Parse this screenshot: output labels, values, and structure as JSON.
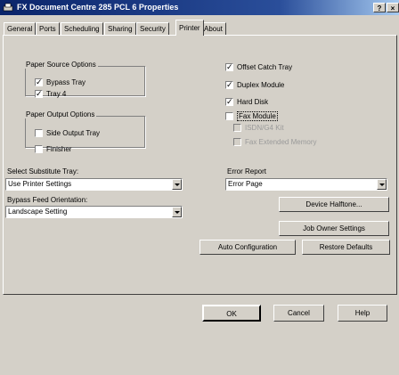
{
  "window": {
    "title": "FX Document Centre 285 PCL 6 Properties",
    "help_label": "?",
    "close_label": "×"
  },
  "tabs": [
    "General",
    "Ports",
    "Scheduling",
    "Sharing",
    "Security",
    "Printer",
    "About"
  ],
  "active_tab": "Printer",
  "paper_source": {
    "title": "Paper Source Options",
    "bypass_tray": {
      "label": "Bypass Tray",
      "checked": true
    },
    "tray_4": {
      "label": "Tray 4",
      "checked": true
    }
  },
  "paper_output": {
    "title": "Paper Output Options",
    "side_output_tray": {
      "label": "Side Output Tray",
      "checked": false
    },
    "finisher": {
      "label": "Finisher",
      "checked": false
    }
  },
  "right_options": {
    "offset_catch_tray": {
      "label": "Offset Catch Tray",
      "checked": true
    },
    "duplex_module": {
      "label": "Duplex Module",
      "checked": true
    },
    "hard_disk": {
      "label": "Hard Disk",
      "checked": true
    },
    "fax_module": {
      "label": "Fax Module",
      "checked": false
    },
    "isdn_g4_kit": {
      "label": "ISDN/G4 Kit",
      "checked": false,
      "enabled": false
    },
    "fax_extended_memory": {
      "label": "Fax Extended Memory",
      "checked": false,
      "enabled": false
    }
  },
  "substitute_tray": {
    "label": "Select Substitute Tray:",
    "value": "Use Printer Settings"
  },
  "error_report": {
    "label": "Error Report",
    "value": "Error Page"
  },
  "bypass_feed": {
    "label": "Bypass Feed Orientation:",
    "value": "Landscape Setting"
  },
  "buttons": {
    "device_halftone": "Device Halftone...",
    "job_owner_settings": "Job Owner Settings",
    "auto_configuration": "Auto Configuration",
    "restore_defaults": "Restore Defaults",
    "ok": "OK",
    "cancel": "Cancel",
    "help": "Help"
  },
  "check_mark": "✓"
}
